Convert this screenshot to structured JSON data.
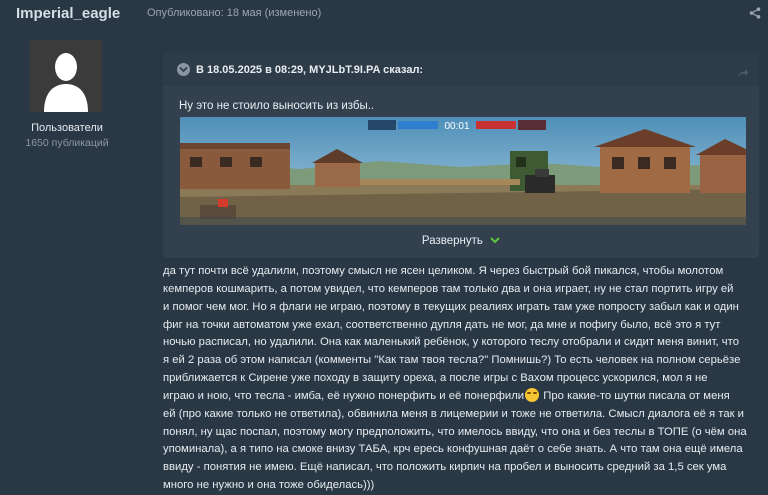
{
  "post": {
    "username": "Imperial_eagle",
    "published": "Опубликовано: 18 мая (изменено)"
  },
  "author": {
    "group": "Пользователи",
    "post_count": "1650 публикаций"
  },
  "quote": {
    "header": "В 18.05.2025 в 08:29, MYJLbT.9I.PA сказал:",
    "text": "Ну это не стоило выносить из избы..",
    "expand_label": "Развернуть",
    "game_timer": "00:01"
  },
  "body": {
    "lines": [
      "да тут почти всё удалили, поэтому смысл не ясен целиком. Я через быстрый бой пикался, чтобы молотом",
      "кемперов кошмарить, а потом увидел, что кемперов там только два и она играет, ну не стал портить игру ей",
      "и помог чем мог. Но я флаги не играю, поэтому в текущих реалиях играть там уже попросту забыл как и один",
      "фиг на точки автоматом уже ехал, соответственно дупля дать не мог, да мне и пофигу было, всё это я тут",
      "ночью расписал, но удалили. Она как маленький ребёнок, у которого теслу отобрали и сидит меня винит, что",
      "я ей 2 раза об этом написал (комменты \"Как там твоя тесла?\" Помнишь?) То есть человек на полном серьёзе",
      "приближается к Сирене уже походу в защиту ореха, а после игры с Вахом процесс ускорился, мол я не",
      "играю и ною, что тесла - имба, её нужно понерфить и её понерфили"
    ],
    "line8_rest": " Про какие-то шутки писала от меня",
    "lines_rest": [
      "ей (про какие только не ответила), обвинила меня в лицемерии и тоже не ответила. Смысл диалога её я так и",
      "понял, ну щас поспал, поэтому могу предположить, что имелось ввиду, что она и без теслы в ТОПЕ (о чём она",
      "упоминала), а я типо на смоке внизу ТАБА, крч ересь конфушная даёт о себе знать. А что там она ещё имела",
      "ввиду - понятия не имею. Ещё написал, что положить кирпич на пробел и выносить средний за 1,5 сек ума",
      "много не нужно и она тоже обиделась)))"
    ]
  },
  "colors": {
    "background": "#2a3744",
    "quote_bg": "#33414f",
    "accent_green": "#5cc63a"
  }
}
